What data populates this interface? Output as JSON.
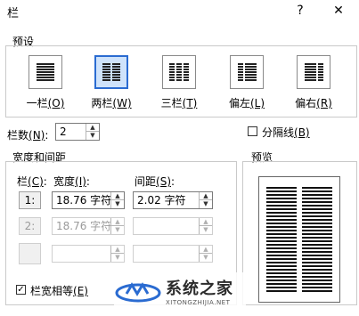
{
  "window": {
    "title": "栏",
    "help_label": "?",
    "close_label": "✕"
  },
  "presets": {
    "group_label": "预设",
    "items": [
      {
        "label": "一栏",
        "key": "(O)",
        "columns": 1,
        "selected": false
      },
      {
        "label": "两栏",
        "key": "(W)",
        "columns": 2,
        "selected": true
      },
      {
        "label": "三栏",
        "key": "(T)",
        "columns": 3,
        "selected": false
      },
      {
        "label": "偏左",
        "key": "(L)",
        "columns": 2,
        "selected": false
      },
      {
        "label": "偏右",
        "key": "(R)",
        "columns": 2,
        "selected": false
      }
    ]
  },
  "column_count": {
    "label": "栏数",
    "key": "(N)",
    "colon": ":",
    "value": "2"
  },
  "separator": {
    "label": "分隔线",
    "key": "(B)",
    "checked": false
  },
  "width_spacing": {
    "group_label": "宽度和间距",
    "col_header": "栏",
    "col_key": "(C)",
    "col_colon": ":",
    "width_header": "宽度",
    "width_key": "(I)",
    "width_colon": ":",
    "spacing_header": "间距",
    "spacing_key": "(S)",
    "spacing_colon": ":",
    "rows": [
      {
        "num": "1:",
        "width": "18.76 字符",
        "spacing": "2.02 字符"
      },
      {
        "num": "2:",
        "width": "18.76 字符",
        "spacing": ""
      },
      {
        "num": "",
        "width": "",
        "spacing": ""
      }
    ],
    "equal_width": {
      "label": "栏宽相等",
      "key": "(E)",
      "checked": true
    }
  },
  "preview": {
    "group_label": "预览"
  },
  "watermark": {
    "name": "系统之家",
    "domain": "XITONGZHIJIA.NET"
  },
  "colors": {
    "accent": "#2a6bd1",
    "selected_bg": "#cfe3fb"
  }
}
